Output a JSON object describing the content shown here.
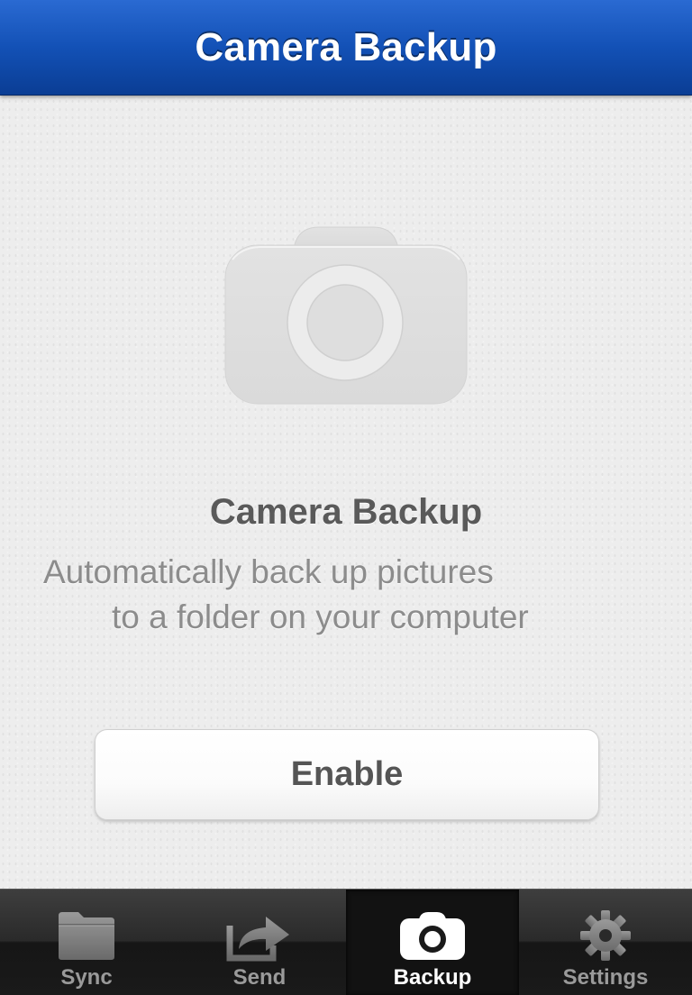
{
  "header": {
    "title": "Camera Backup"
  },
  "main": {
    "illustration_icon": "camera-icon",
    "title": "Camera Backup",
    "description_line1": "Automatically back up pictures",
    "description_line2": "to a folder on your computer",
    "enable_button_label": "Enable"
  },
  "tabbar": {
    "active_tab": "Backup",
    "tabs": [
      {
        "label": "Sync",
        "icon": "folder-icon"
      },
      {
        "label": "Send",
        "icon": "share-arrow-icon"
      },
      {
        "label": "Backup",
        "icon": "camera-icon"
      },
      {
        "label": "Settings",
        "icon": "gear-icon"
      }
    ]
  },
  "colors": {
    "navbar_blue": "#1351b6",
    "background": "#ededed",
    "tabbar_dark": "#2a2a2a"
  }
}
